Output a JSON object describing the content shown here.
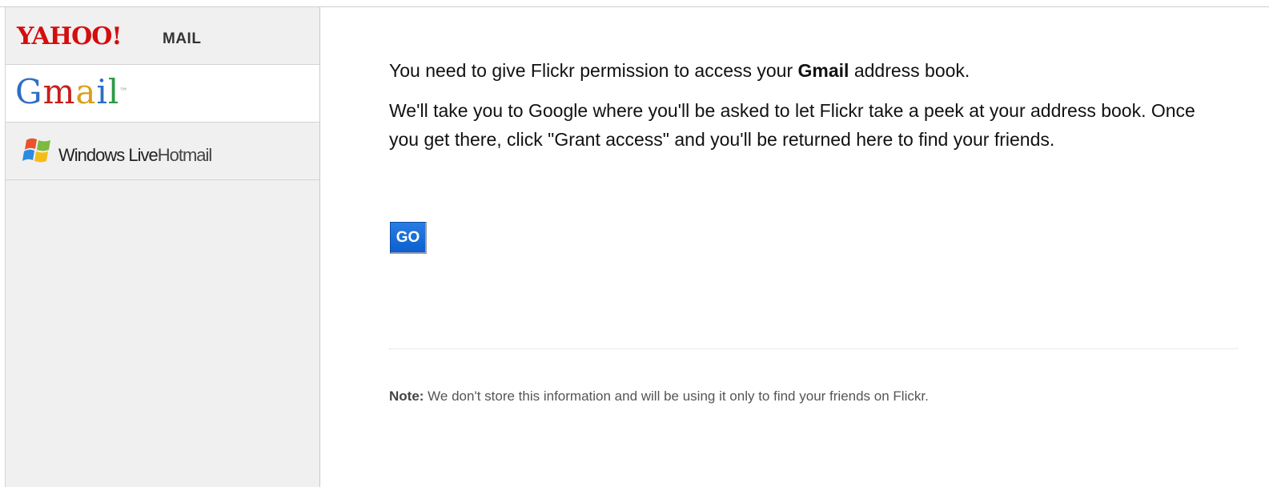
{
  "sidebar": {
    "providers": [
      {
        "id": "yahoo",
        "logo_text": "YAHOO!",
        "suffix": "MAIL",
        "selected": false
      },
      {
        "id": "gmail",
        "logo_text": "Gmail",
        "selected": true
      },
      {
        "id": "hotmail",
        "logo_text_1": "Windows Live",
        "logo_text_2": "Hotmail",
        "selected": false
      }
    ]
  },
  "main": {
    "intro_before": "You need to give Flickr permission to access your ",
    "intro_bold": "Gmail",
    "intro_after": " address book.",
    "explanation": "We'll take you to Google where you'll be asked to let Flickr take a peek at your address book. Once you get there, click \"Grant access\" and you'll be returned here to find your friends.",
    "go_label": "GO",
    "note_label": "Note:",
    "note_text": " We don't store this information and will be using it only to find your friends on Flickr."
  },
  "colors": {
    "button_blue": "#1a6fd9",
    "yahoo_red": "#d40d0d",
    "sidebar_bg": "#f0f0f0"
  }
}
